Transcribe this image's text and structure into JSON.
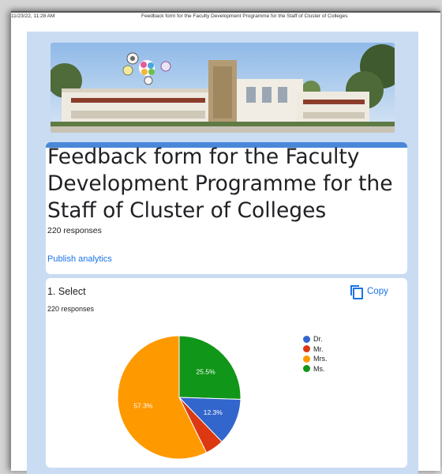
{
  "print_header": {
    "timestamp": "11/23/22, 11:28 AM",
    "page_title": "Feedback form for the Faculty Development Programme for the Staff of Cluster of Colleges"
  },
  "form": {
    "title": "Feedback form for the Faculty Development Programme for the Staff of Cluster of Colleges",
    "responses": "220 responses",
    "publish_label": "Publish analytics"
  },
  "question": {
    "title": "1. Select",
    "responses": "220 responses",
    "copy_label": "Copy"
  },
  "colors": {
    "accent": "#4a87d9",
    "link": "#1a73e8",
    "background": "#c9dcf2"
  },
  "chart_data": {
    "type": "pie",
    "categories": [
      "Dr.",
      "Mr.",
      "Mrs.",
      "Ms."
    ],
    "values": [
      12.3,
      4.9,
      57.3,
      25.5
    ],
    "labels": [
      "12.3%",
      "",
      "57.3%",
      "25.5%"
    ],
    "colors": [
      "#3366cc",
      "#dc3912",
      "#ff9900",
      "#109618"
    ],
    "legend_position": "right"
  }
}
